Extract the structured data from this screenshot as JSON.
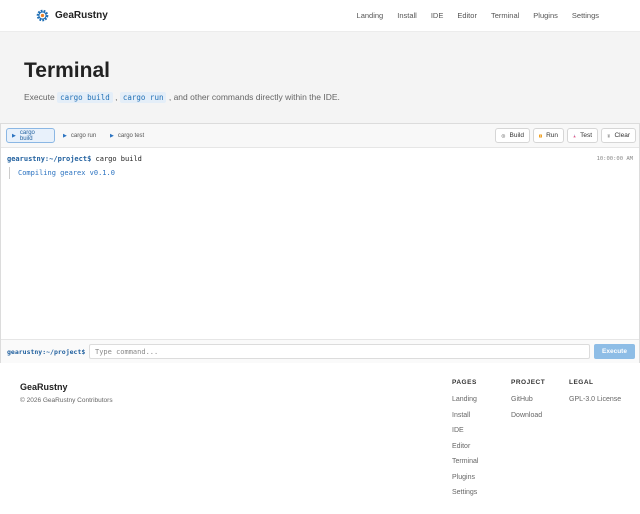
{
  "nav": {
    "brand": "GeaRustny",
    "links": [
      "Landing",
      "Install",
      "IDE",
      "Editor",
      "Terminal",
      "Plugins",
      "Settings"
    ]
  },
  "hero": {
    "title": "Terminal",
    "sub_prefix": "Execute ",
    "chip1": "cargo build",
    "sep": " , ",
    "chip2": "cargo run",
    "sub_suffix": " , and other commands directly within the IDE."
  },
  "terminal": {
    "tabs": [
      "cargo build",
      "cargo run",
      "cargo test"
    ],
    "active_tab": "cargo build",
    "buttons": {
      "build": "Build",
      "run": "Run",
      "test": "Test",
      "clear": "Clear"
    },
    "prompt": "gearustny:~/project$",
    "command": " cargo build",
    "timestamp": "10:00:00 AM",
    "output": "Compiling gearex v0.1.0",
    "input_placeholder": "Type command...",
    "execute_label": "Execute"
  },
  "footer": {
    "brand": "GeaRustny",
    "copyright": "© 2026 GeaRustny Contributors",
    "columns": [
      {
        "title": "PAGES",
        "links": [
          "Landing",
          "Install",
          "IDE",
          "Editor",
          "Terminal",
          "Plugins",
          "Settings"
        ]
      },
      {
        "title": "PROJECT",
        "links": [
          "GitHub",
          "Download"
        ]
      },
      {
        "title": "LEGAL",
        "links": [
          "GPL-3.0 License"
        ]
      }
    ]
  },
  "colors": {
    "accent": "#1f5f9e",
    "execute": "#8ebde6",
    "hero_bg": "#f4f4f4"
  },
  "icons": {
    "logo": "gear-icon",
    "build": "gear-icon",
    "run": "play-icon",
    "test": "flask-icon",
    "clear": "trash-icon"
  }
}
